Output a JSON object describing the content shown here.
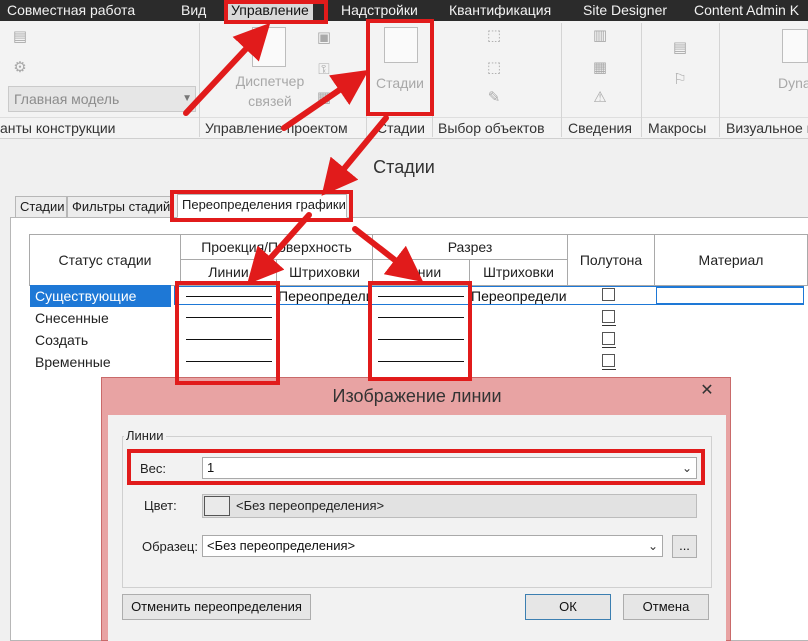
{
  "menubar": {
    "items": [
      "Совместная работа",
      "Вид",
      "Управление",
      "Надстройки",
      "Квантификация",
      "Site Designer",
      "Content Admin K"
    ],
    "active": "Управление"
  },
  "ribbon": {
    "model_select": "Главная модель",
    "buttons": {
      "manager_line1": "Диспетчер",
      "manager_line2": "связей",
      "stages": "Стадии",
      "dynamo": "Dyna"
    },
    "panels": [
      "анты конструкции",
      "Управление проектом",
      "Стадии",
      "Выбор объектов",
      "Сведения",
      "Макросы",
      "Визуальное п"
    ]
  },
  "stages_dialog": {
    "title": "Стадии",
    "tabs": [
      "Стадии",
      "Фильтры стадий",
      "Переопределения графики"
    ],
    "active_tab": "Переопределения графики",
    "table": {
      "col_status": "Статус стадии",
      "group_projection": "Проекция/Поверхность",
      "group_section": "Разрез",
      "sub_lines": "Линии",
      "sub_hatch": "Штриховки",
      "col_halftone": "Полутона",
      "col_material": "Материал",
      "rows": [
        "Существующие",
        "Снесенные",
        "Создать",
        "Временные"
      ],
      "override_text": "Переопределит"
    }
  },
  "line_dialog": {
    "title": "Изображение линии",
    "close": "✕",
    "group_label": "Линии",
    "weight_label": "Вес:",
    "weight_value": "1",
    "color_label": "Цвет:",
    "color_value": "<Без переопределения>",
    "pattern_label": "Образец:",
    "pattern_value": "<Без переопределения>",
    "browse": "...",
    "reset_button": "Отменить переопределения",
    "ok_button": "ОК",
    "cancel_button": "Отмена"
  },
  "colors": {
    "annotation_red": "#e11b1b",
    "selection_blue": "#1e78d6",
    "modal_title_bg": "#e8a3a3"
  }
}
